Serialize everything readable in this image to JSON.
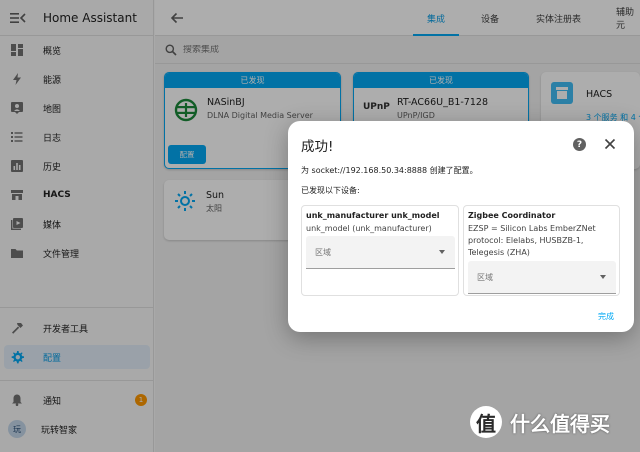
{
  "app": {
    "title": "Home Assistant"
  },
  "sidebar": {
    "items": [
      {
        "label": "概览",
        "icon": "dashboard-icon"
      },
      {
        "label": "能源",
        "icon": "lightning-icon"
      },
      {
        "label": "地图",
        "icon": "map-icon"
      },
      {
        "label": "日志",
        "icon": "logbook-icon"
      },
      {
        "label": "历史",
        "icon": "history-chart-icon"
      },
      {
        "label": "HACS",
        "icon": "hacs-icon"
      },
      {
        "label": "媒体",
        "icon": "media-icon"
      },
      {
        "label": "文件管理",
        "icon": "folder-icon"
      }
    ],
    "dev_tools": {
      "label": "开发者工具",
      "icon": "hammer-icon"
    },
    "settings": {
      "label": "配置",
      "icon": "gear-icon"
    },
    "notifications": {
      "label": "通知",
      "icon": "bell-icon",
      "count": "1"
    },
    "user": {
      "label": "玩转智家",
      "avatar": "玩"
    }
  },
  "tabs": [
    "集成",
    "设备",
    "实体注册表",
    "辅助元"
  ],
  "search": {
    "placeholder": "搜索集成"
  },
  "cards": {
    "discovered_header": "已发现",
    "card1": {
      "name": "NASinBJ",
      "sub": "DLNA Digital Media Server",
      "button": "配置"
    },
    "card2": {
      "name": "RT-AC66U_B1-7128",
      "sub": "UPnP/IGD",
      "logo": "UPnP"
    },
    "card3": {
      "name": "HACS",
      "link": "3 个服务 和 4 个"
    },
    "card4": {
      "name": "Sun",
      "sub": "太阳"
    }
  },
  "dialog": {
    "title": "成功!",
    "message": "为 socket://192.168.50.34:8888 创建了配置。",
    "devices_header": "已发现以下设备:",
    "devices": [
      {
        "name": "unk_manufacturer unk_model",
        "model": "unk_model (unk_manufacturer)",
        "area_label": "区域"
      },
      {
        "name": "Zigbee Coordinator",
        "model": "EZSP = Silicon Labs EmberZNet protocol: Elelabs, HUSBZB-1, Telegesis (ZHA)",
        "area_label": "区域"
      }
    ],
    "done": "完成"
  },
  "watermark": {
    "text": "什么值得买"
  },
  "colors": {
    "accent": "#03a9f4",
    "badge": "#ff9800"
  }
}
